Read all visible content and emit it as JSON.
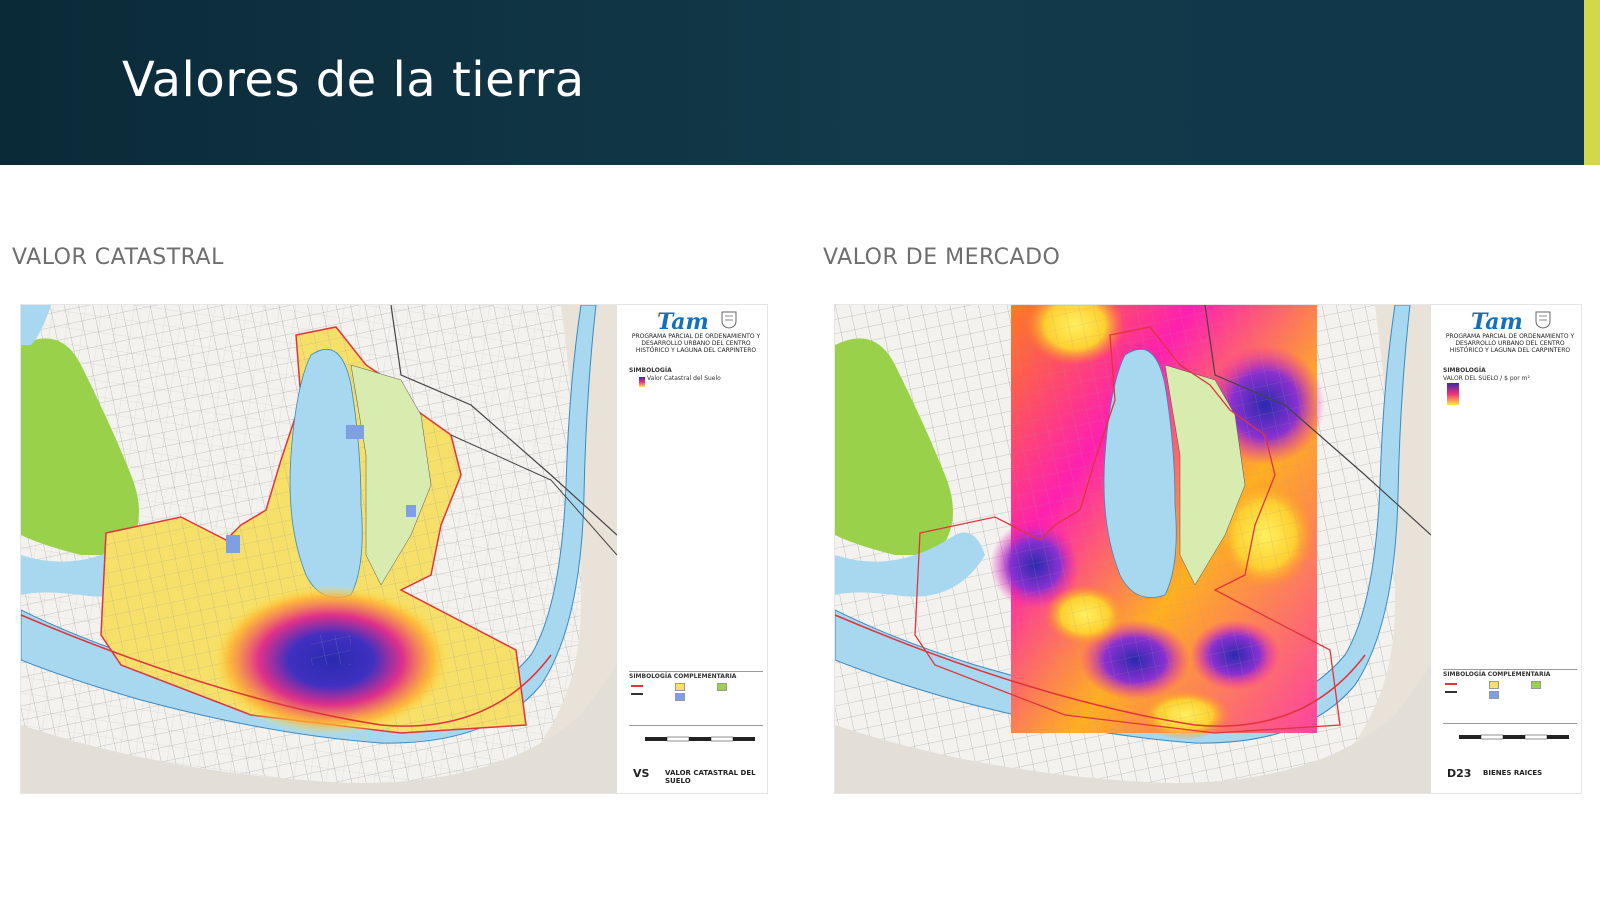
{
  "header": {
    "title": "Valores de la tierra"
  },
  "left_panel": {
    "subtitle": "VALOR CATASTRAL",
    "legend": {
      "brand": "Tam",
      "program": "PROGRAMA PARCIAL DE ORDENAMIENTO Y DESARROLLO URBANO DEL CENTRO HISTÓRICO Y LAGUNA DEL CARPINTERO",
      "simbologia": "SIMBOLOGÍA",
      "item": "Valor Catastral del Suelo",
      "complementaria": "SIMBOLOGÍA COMPLEMENTARIA",
      "code": "VS",
      "sheet_title": "VALOR CATASTRAL DEL SUELO"
    }
  },
  "right_panel": {
    "subtitle": "VALOR DE MERCADO",
    "legend": {
      "brand": "Tam",
      "program": "PROGRAMA PARCIAL DE ORDENAMIENTO Y DESARROLLO URBANO DEL CENTRO HISTÓRICO Y LAGUNA DEL CARPINTERO",
      "simbologia": "SIMBOLOGÍA",
      "item": "VALOR DEL SUELO / $ por m²",
      "complementaria": "SIMBOLOGÍA COMPLEMENTARIA",
      "code": "D23",
      "sheet_title": "BIENES RAICES"
    }
  },
  "colors": {
    "header_bg": "#0f3444",
    "accent": "#d3d84a",
    "water": "#a8d8f0",
    "green": "#9ad14a",
    "boundary": "#e0343c",
    "heat_low": "#ffe640",
    "heat_mid": "#f0307a",
    "heat_high": "#3a2aa8"
  }
}
